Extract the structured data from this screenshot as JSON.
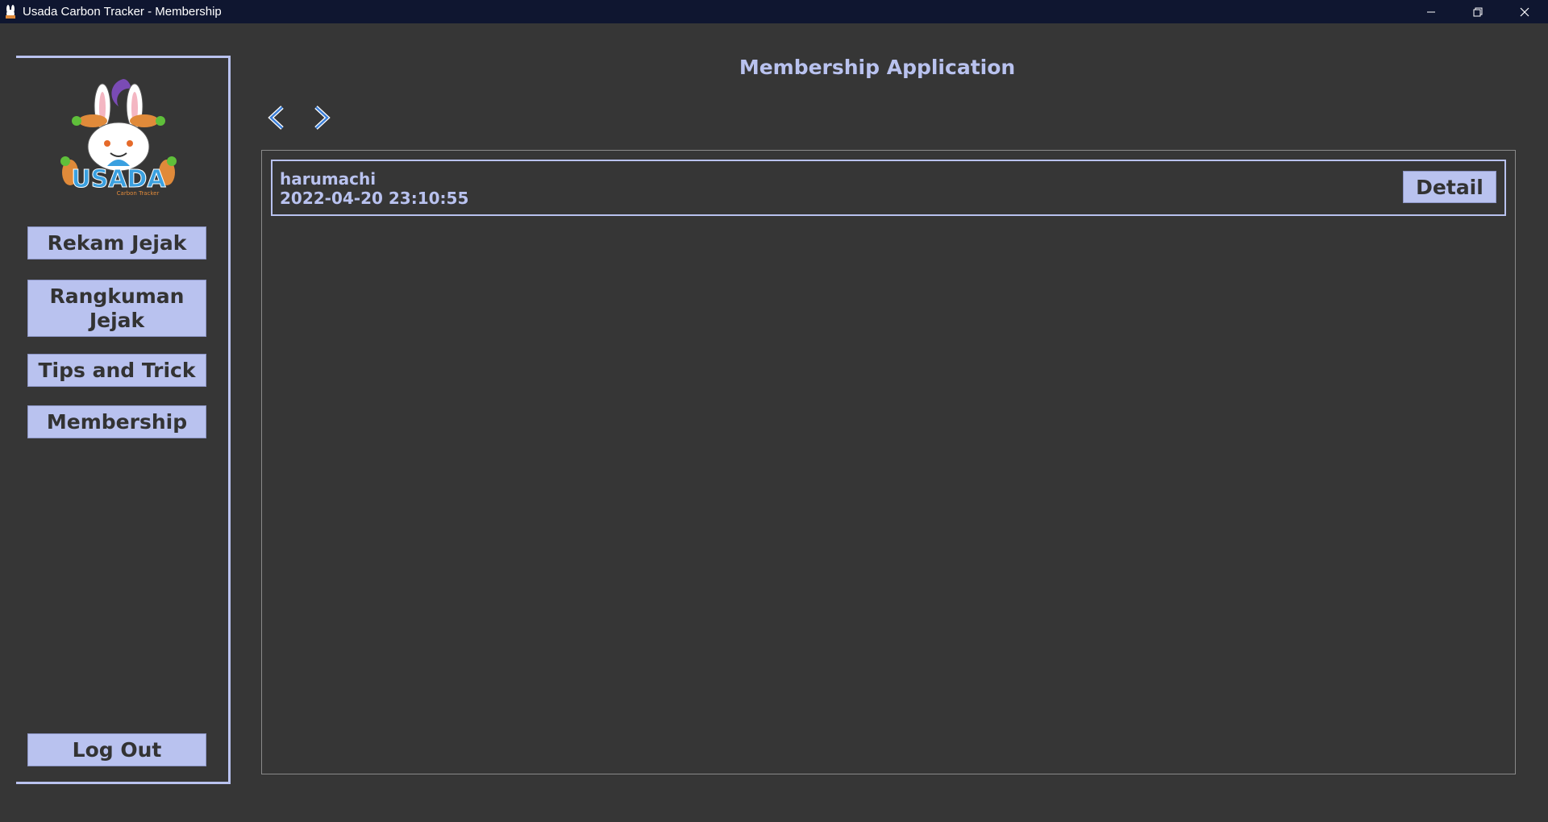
{
  "window": {
    "title": "Usada Carbon Tracker - Membership",
    "controls": [
      "minimize-icon",
      "restore-icon",
      "close-icon"
    ]
  },
  "sidebar": {
    "logo": {
      "text": "USADA",
      "subtext": "Carbon Tracker"
    },
    "items": [
      {
        "label": "Rekam Jejak"
      },
      {
        "label": "Rangkuman Jejak"
      },
      {
        "label": "Tips and Trick"
      },
      {
        "label": "Membership"
      }
    ],
    "logout_label": "Log Out"
  },
  "main": {
    "title": "Membership Application",
    "nav": {
      "prev_icon": "chevron-left-icon",
      "next_icon": "chevron-right-icon"
    },
    "applications": [
      {
        "username": "harumachi",
        "timestamp": "2022-04-20 23:10:55",
        "action_label": "Detail"
      }
    ]
  },
  "colors": {
    "background": "#363636",
    "accent": "#b9c2ef",
    "button_text": "#333333",
    "titlebar": "#0f1630"
  }
}
